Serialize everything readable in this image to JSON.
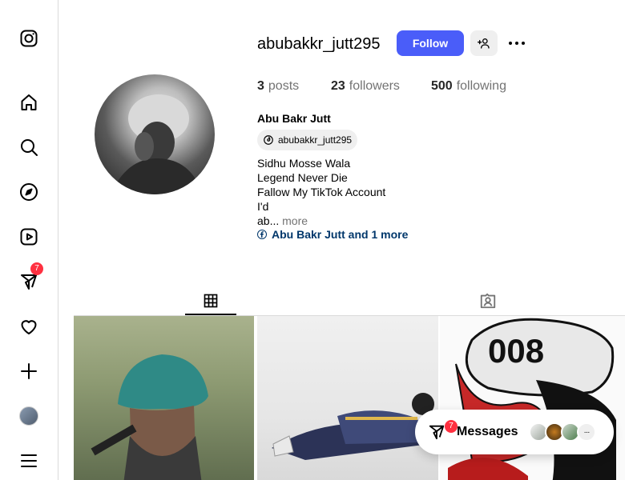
{
  "sidebar": {
    "items": [
      {
        "name": "instagram-logo-icon"
      },
      {
        "name": "home-icon"
      },
      {
        "name": "search-icon"
      },
      {
        "name": "explore-icon"
      },
      {
        "name": "reels-icon"
      },
      {
        "name": "messenger-icon",
        "badge": "7"
      },
      {
        "name": "notifications-heart-icon"
      },
      {
        "name": "create-plus-icon"
      },
      {
        "name": "profile-avatar"
      },
      {
        "name": "menu-icon"
      }
    ]
  },
  "profile": {
    "username": "abubakkr_jutt295",
    "follow_label": "Follow",
    "stats": [
      {
        "num": "3",
        "label": "posts"
      },
      {
        "num": "23",
        "label": "followers"
      },
      {
        "num": "500",
        "label": "following"
      }
    ],
    "full_name": "Abu Bakr Jutt",
    "threads_handle": "abubakkr_jutt295",
    "bio_lines": [
      "Sidhu Mosse Wala",
      "Legend Never Die ",
      "Fallow My TikTok Account",
      "I'd",
      "ab..."
    ],
    "more_label": "more",
    "links_text": "Abu Bakr Jutt and 1 more"
  },
  "tabs": [
    {
      "name": "posts-grid-tab",
      "active": true
    },
    {
      "name": "tagged-tab",
      "active": false
    }
  ],
  "messages": {
    "label": "Messages",
    "badge": "7",
    "more_label": "···"
  },
  "colors": {
    "accent": "#4a5df9",
    "badge": "#ff3040",
    "link": "#00376b",
    "muted": "#737373"
  }
}
